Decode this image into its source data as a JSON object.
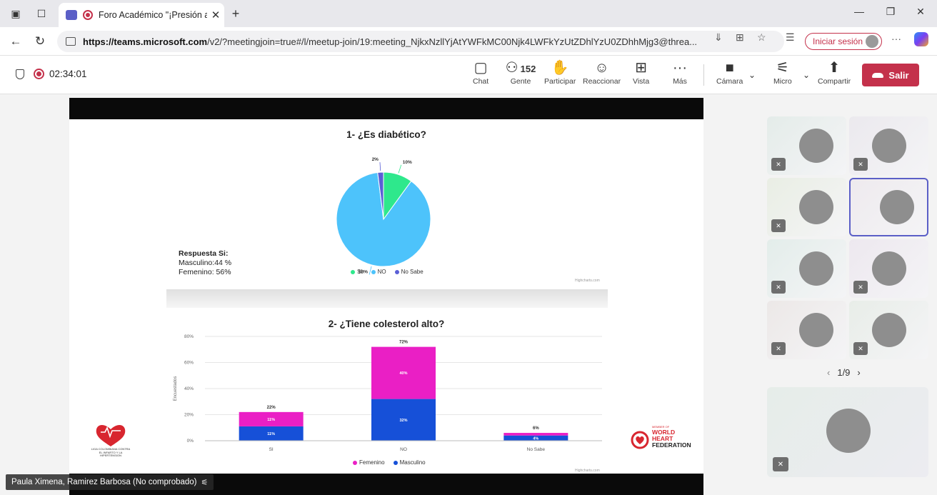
{
  "browser": {
    "tab_title": "Foro Académico \"¡Presión ar",
    "url_host": "https://teams.microsoft.com",
    "url_rest": "/v2/?meetingjoin=true#/l/meetup-join/19:meeting_NjkxNzllYjAtYWFkMC00Njk4LWFkYzUtZDhlYzU0ZDhhMjg3@threa...",
    "signin_label": "Iniciar sesión"
  },
  "meeting": {
    "elapsed": "02:34:01",
    "people_count": "152",
    "tools": {
      "chat": "Chat",
      "people": "Gente",
      "raise": "Participar",
      "react": "Reaccionar",
      "view": "Vista",
      "more": "Más",
      "camera": "Cámara",
      "mic": "Micro",
      "share": "Compartir",
      "leave": "Salir"
    },
    "presenter": "Paula Ximena, Ramirez Barbosa (No comprobado)",
    "pager": "1/9"
  },
  "slide": {
    "chart1_title": "1- ¿Es diabético?",
    "resp_title": "Respuesta Si:",
    "resp_male": "Masculino:44 %",
    "resp_female": "Femenino: 56%",
    "chart2_title": "2- ¿Tiene colesterol alto?",
    "credits": "Highcharts.com",
    "liga_text": "LIGA COLOMBIANA CONTRA EL INFARTO Y LA HIPERTENSION",
    "whf_small": "MEMBER OF",
    "whf_line1": "WORLD",
    "whf_line2": "HEART",
    "whf_line3": "FEDERATION"
  },
  "chart_data": [
    {
      "type": "pie",
      "title": "1- ¿Es diabético?",
      "categories": [
        "SI",
        "NO",
        "No Sabe"
      ],
      "values": [
        10,
        88,
        2
      ],
      "labels": [
        "10%",
        "88%",
        "2%"
      ],
      "colors": [
        "#2ee88c",
        "#4dc3fb",
        "#5a5fd6"
      ],
      "legend": "bottom"
    },
    {
      "type": "bar",
      "stacked": true,
      "title": "2- ¿Tiene colesterol alto?",
      "ylabel": "Encuestados",
      "categories": [
        "SI",
        "NO",
        "No Sabe"
      ],
      "yticks": [
        "0%",
        "20%",
        "40%",
        "60%",
        "80%"
      ],
      "ylim": [
        0,
        80
      ],
      "totals": [
        "22%",
        "72%",
        "6%"
      ],
      "series": [
        {
          "name": "Masculino",
          "color": "#1650d8",
          "values": [
            11,
            32,
            4
          ],
          "labels": [
            "11%",
            "32%",
            "4%"
          ]
        },
        {
          "name": "Femenino",
          "color": "#ea1fc5",
          "values": [
            11,
            40,
            2
          ],
          "labels": [
            "11%",
            "40%",
            ""
          ]
        }
      ],
      "legend": "bottom"
    }
  ]
}
